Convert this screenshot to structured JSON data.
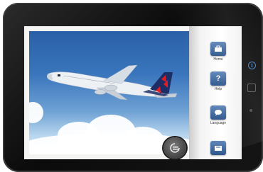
{
  "app": {
    "brand_colors": {
      "accent": "#2d568c",
      "tail": "#1d2d66",
      "tail_accent": "#e31b23",
      "sky": "#3a76bd"
    }
  },
  "sidebar": {
    "items": [
      {
        "label": "Home",
        "icon": "home-icon"
      },
      {
        "label": "Help",
        "icon": "help-icon",
        "glyph": "?"
      },
      {
        "label": "Language",
        "icon": "speech-bubble-icon"
      },
      {
        "label": "",
        "icon": "archive-icon"
      }
    ]
  },
  "controls": {
    "back_icon": "circular-back-icon",
    "info_icon": "info-icon",
    "info_glyph": "i"
  }
}
